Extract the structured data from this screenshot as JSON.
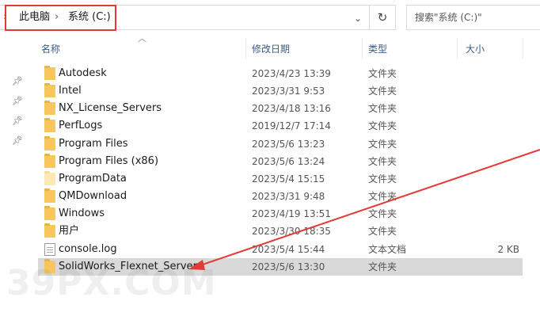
{
  "address_bar": {
    "leading_chevron": "›",
    "breadcrumbs": [
      "此电脑",
      "系统 (C:)"
    ],
    "separator": "›",
    "dropdown_icon": "chevron-down-icon",
    "refresh_icon": "refresh-icon"
  },
  "search": {
    "placeholder": "搜索\"系统 (C:)\""
  },
  "columns": {
    "name": "名称",
    "date": "修改日期",
    "type": "类型",
    "size": "大小"
  },
  "rows": [
    {
      "name": "Autodesk",
      "date": "2023/4/23 13:39",
      "type": "文件夹",
      "size": "",
      "icon": "folder-icon"
    },
    {
      "name": "Intel",
      "date": "2023/3/31 9:53",
      "type": "文件夹",
      "size": "",
      "icon": "folder-icon"
    },
    {
      "name": "NX_License_Servers",
      "date": "2023/4/18 13:16",
      "type": "文件夹",
      "size": "",
      "icon": "folder-icon"
    },
    {
      "name": "PerfLogs",
      "date": "2019/12/7 17:14",
      "type": "文件夹",
      "size": "",
      "icon": "folder-icon"
    },
    {
      "name": "Program Files",
      "date": "2023/5/6 13:23",
      "type": "文件夹",
      "size": "",
      "icon": "folder-icon"
    },
    {
      "name": "Program Files (x86)",
      "date": "2023/5/6 13:24",
      "type": "文件夹",
      "size": "",
      "icon": "folder-icon"
    },
    {
      "name": "ProgramData",
      "date": "2023/5/4 15:15",
      "type": "文件夹",
      "size": "",
      "icon": "folder-hidden-icon"
    },
    {
      "name": "QMDownload",
      "date": "2023/3/31 9:48",
      "type": "文件夹",
      "size": "",
      "icon": "folder-icon"
    },
    {
      "name": "Windows",
      "date": "2023/4/19 13:51",
      "type": "文件夹",
      "size": "",
      "icon": "folder-icon"
    },
    {
      "name": "用户",
      "date": "2023/3/30 18:35",
      "type": "文件夹",
      "size": "",
      "icon": "folder-icon"
    },
    {
      "name": "console.log",
      "date": "2023/5/4 15:44",
      "type": "文本文档",
      "size": "2 KB",
      "icon": "text-file-icon"
    },
    {
      "name": "SolidWorks_Flexnet_Server",
      "date": "2023/5/6 13:30",
      "type": "文件夹",
      "size": "",
      "icon": "folder-icon",
      "selected": true
    }
  ],
  "watermark": "39PX.COM",
  "colors": {
    "highlight": "#e53935",
    "selected_row": "#d9d9d9",
    "header_text": "#3c5a85",
    "folder": "#f5c75d"
  }
}
